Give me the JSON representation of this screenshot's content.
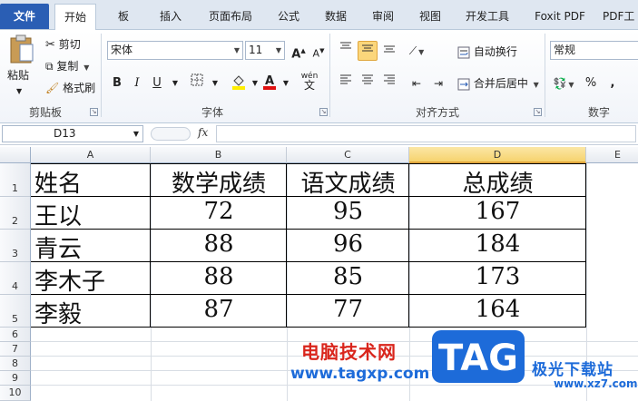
{
  "tabs": [
    "文件",
    "开始",
    "板",
    "插入",
    "页面布局",
    "公式",
    "数据",
    "审阅",
    "视图",
    "开发工具",
    "Foxit PDF",
    "PDF工"
  ],
  "ribbon": {
    "clipboard": {
      "paste": "粘贴",
      "cut": "剪切",
      "copy": "复制",
      "format_painter": "格式刷",
      "label": "剪贴板"
    },
    "font": {
      "family": "宋体",
      "size": "11",
      "bold": "B",
      "italic": "I",
      "underline": "U",
      "grow": "A",
      "shrink": "A",
      "label": "字体",
      "wen": "wén",
      "wen_char": "文"
    },
    "alignment": {
      "wrap": "自动换行",
      "merge": "合并后居中",
      "label": "对齐方式"
    },
    "number": {
      "format": "常规",
      "percent": "%",
      "label": "数字"
    }
  },
  "formula_bar": {
    "name_box": "D13",
    "fx": "fx",
    "value": ""
  },
  "sheet": {
    "columns": [
      "A",
      "B",
      "C",
      "D",
      "E"
    ],
    "rows": [
      "1",
      "2",
      "3",
      "4",
      "5",
      "6",
      "7",
      "8",
      "9",
      "10"
    ],
    "header_row": [
      "姓名",
      "数学成绩",
      "语文成绩",
      "总成绩"
    ],
    "data_rows": [
      [
        "王以",
        "72",
        "95",
        "167"
      ],
      [
        "青云",
        "88",
        "96",
        "184"
      ],
      [
        "李木子",
        "88",
        "85",
        "173"
      ],
      [
        "李毅",
        "87",
        "77",
        "164"
      ]
    ],
    "selected_column": "D",
    "selected_cell": "D13"
  },
  "watermark": {
    "brand_cn": "电脑技术网",
    "brand_url": "www.tagxp.com",
    "tag": "TAG",
    "site_cn": "极光下载站",
    "site_url": "www.xz7.com"
  },
  "colors": {
    "file_tab": "#2a5eb4",
    "selected_header": "#f6d36e",
    "watermark_red": "#d9251c",
    "watermark_blue": "#1d6bd9"
  }
}
